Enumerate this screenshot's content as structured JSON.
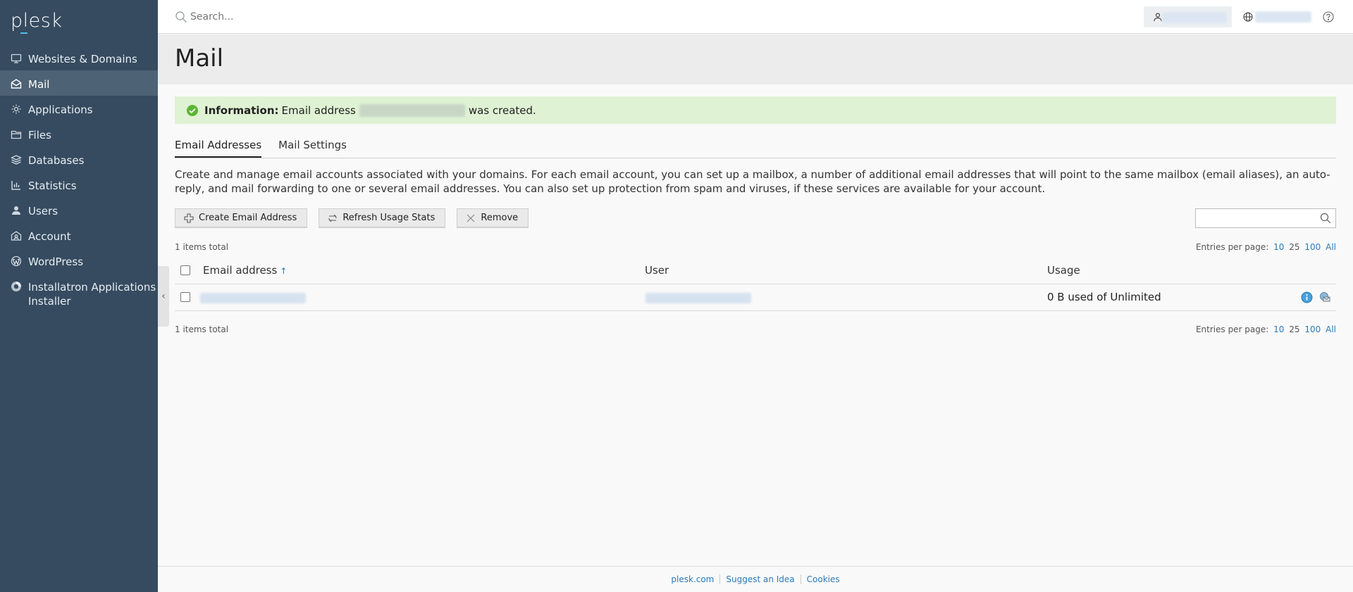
{
  "brand": {
    "logo_text": "plesk"
  },
  "sidebar": {
    "items": [
      {
        "label": "Websites & Domains",
        "icon": "monitor-icon"
      },
      {
        "label": "Mail",
        "icon": "mail-icon",
        "active": true
      },
      {
        "label": "Applications",
        "icon": "gear-icon"
      },
      {
        "label": "Files",
        "icon": "folder-icon"
      },
      {
        "label": "Databases",
        "icon": "database-icon"
      },
      {
        "label": "Statistics",
        "icon": "bar-chart-icon"
      },
      {
        "label": "Users",
        "icon": "user-icon"
      },
      {
        "label": "Account",
        "icon": "account-icon"
      },
      {
        "label": "WordPress",
        "icon": "wordpress-icon"
      },
      {
        "label": "Installatron Applications Installer",
        "icon": "installatron-icon"
      }
    ],
    "collapse_glyph": "‹"
  },
  "topbar": {
    "search_placeholder": "Search..."
  },
  "page": {
    "title": "Mail"
  },
  "alert": {
    "label": "Information:",
    "text_before": "Email address",
    "text_after": "was created."
  },
  "tabs": [
    {
      "label": "Email Addresses",
      "active": true
    },
    {
      "label": "Mail Settings",
      "active": false
    }
  ],
  "description": "Create and manage email accounts associated with your domains. For each email account, you can set up a mailbox, a number of additional email addresses that will point to the same mailbox (email aliases), an auto-reply, and mail forwarding to one or several email addresses. You can also set up protection from spam and viruses, if these services are available for your account.",
  "toolbar": {
    "create_label": "Create Email Address",
    "refresh_label": "Refresh Usage Stats",
    "remove_label": "Remove"
  },
  "list": {
    "total_text": "1 items total",
    "entries_label": "Entries per page:",
    "page_sizes": [
      "10",
      "25",
      "100",
      "All"
    ],
    "columns": {
      "email": "Email address",
      "user": "User",
      "usage": "Usage"
    },
    "sort_glyph": "↑",
    "rows": [
      {
        "usage": "0 B used of Unlimited"
      }
    ]
  },
  "footer": {
    "links": [
      "plesk.com",
      "Suggest an Idea",
      "Cookies"
    ]
  },
  "colors": {
    "sidebar_bg": "#364b5f",
    "sidebar_active": "#4d6275",
    "accent_link": "#2a7ab9",
    "success_bg": "#dff2d4",
    "success_icon": "#5bb533"
  }
}
